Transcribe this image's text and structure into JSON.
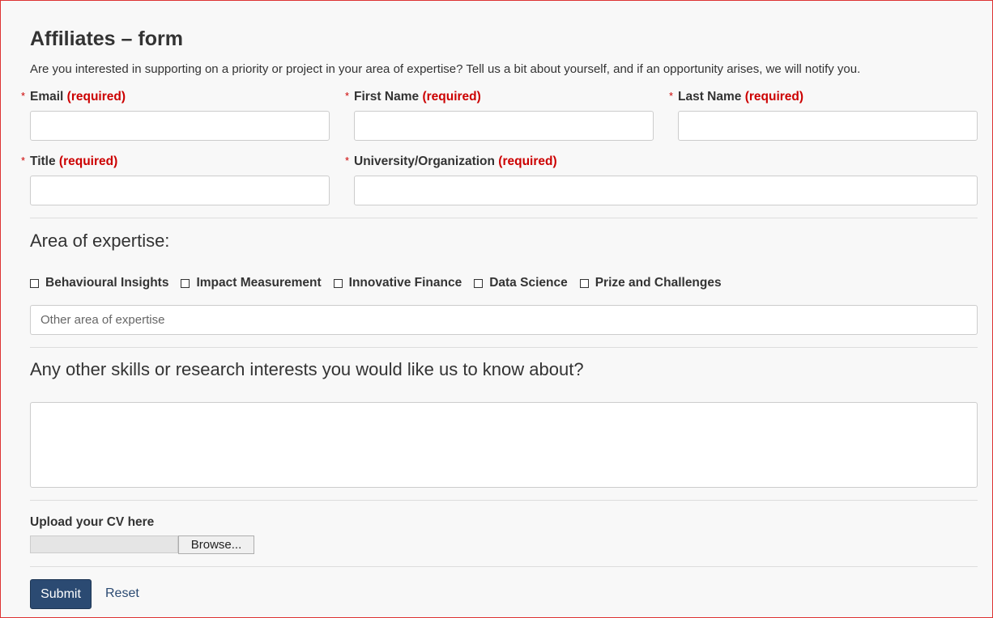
{
  "header": {
    "title": "Affiliates – form",
    "intro": "Are you interested in supporting on a priority or project in your area of expertise? Tell us a bit about yourself, and if an opportunity arises, we will notify you."
  },
  "fields": {
    "required_marker": "*",
    "required_text": "(required)",
    "email": {
      "label": "Email",
      "value": ""
    },
    "first_name": {
      "label": "First Name",
      "value": ""
    },
    "last_name": {
      "label": "Last Name",
      "value": ""
    },
    "title": {
      "label": "Title",
      "value": ""
    },
    "organization": {
      "label": "University/Organization",
      "value": ""
    }
  },
  "expertise": {
    "heading": "Area of expertise:",
    "options": [
      {
        "label": "Behavioural Insights",
        "checked": false
      },
      {
        "label": "Impact Measurement",
        "checked": false
      },
      {
        "label": "Innovative Finance",
        "checked": false
      },
      {
        "label": "Data Science",
        "checked": false
      },
      {
        "label": "Prize and Challenges",
        "checked": false
      }
    ],
    "other_placeholder": "Other area of expertise"
  },
  "skills": {
    "heading": "Any other skills or research interests you would like us to know about?",
    "value": ""
  },
  "upload": {
    "label": "Upload your CV here",
    "browse_label": "Browse..."
  },
  "actions": {
    "submit_label": "Submit",
    "reset_label": "Reset"
  },
  "colors": {
    "required": "#cc0000",
    "primary": "#2b4a72",
    "background": "#f8f8f8"
  }
}
